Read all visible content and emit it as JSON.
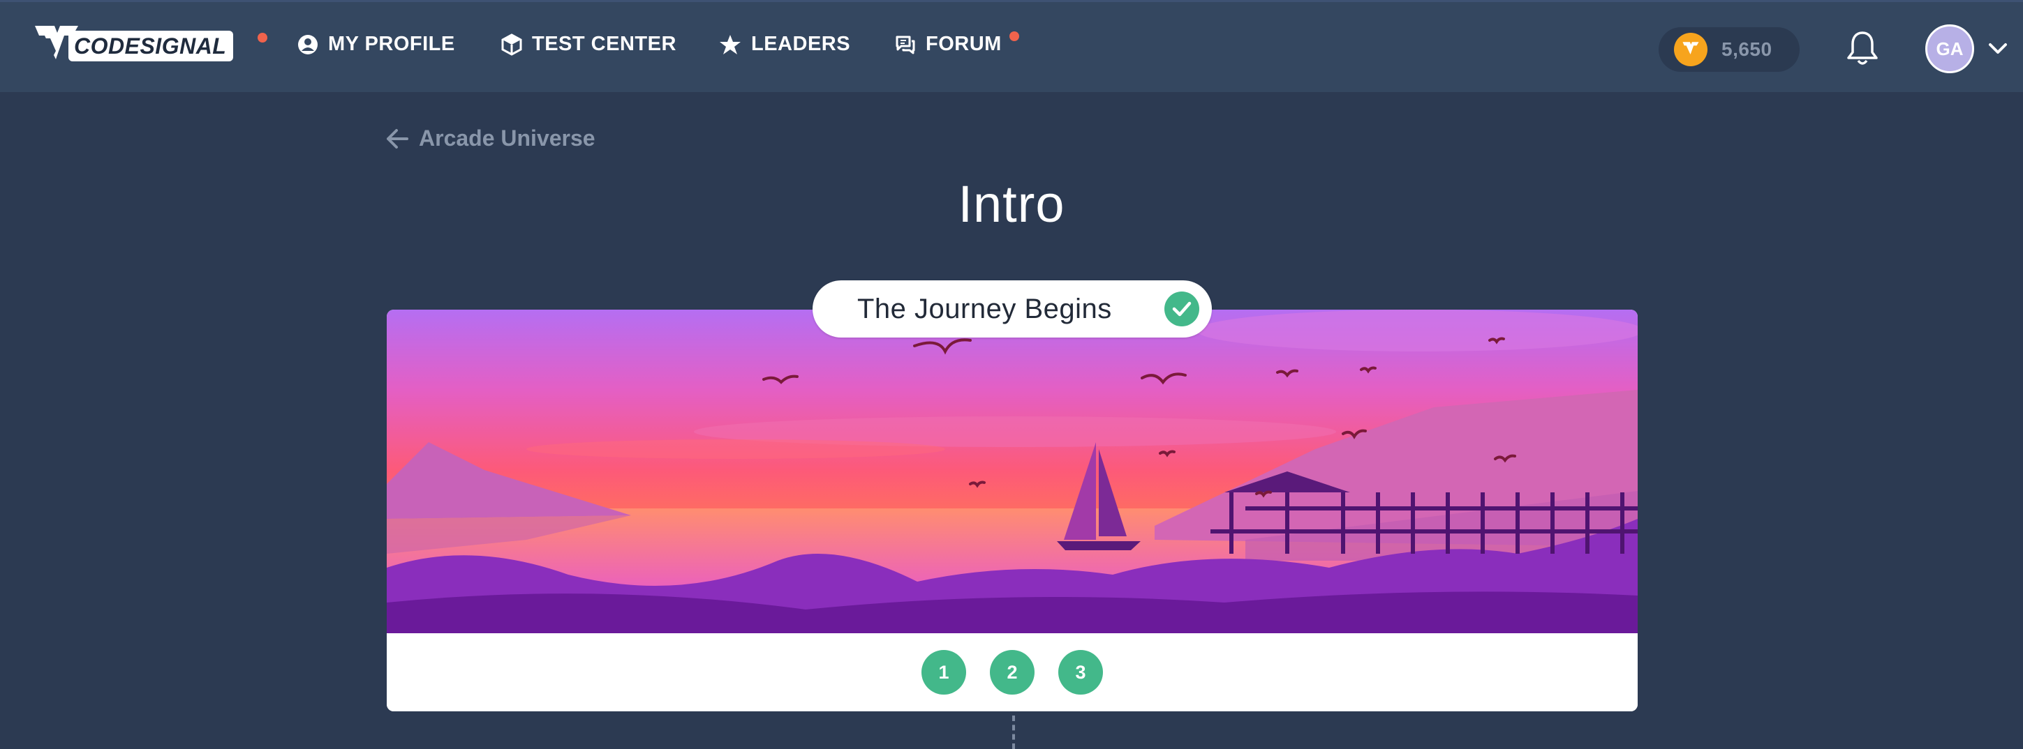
{
  "header": {
    "logo_text": "CODESIGNAL",
    "nav": [
      {
        "label": "MY PROFILE",
        "icon": "user-circle-icon"
      },
      {
        "label": "TEST CENTER",
        "icon": "cube-icon"
      },
      {
        "label": "LEADERS",
        "icon": "star-icon"
      },
      {
        "label": "FORUM",
        "icon": "chat-icon"
      }
    ],
    "coins": "5,650",
    "avatar_initials": "GA",
    "notification_color": "#f0634c"
  },
  "breadcrumb": {
    "back_label": "Arcade Universe"
  },
  "page": {
    "title": "Intro"
  },
  "chapter": {
    "name": "The Journey Begins",
    "completed": true,
    "levels": [
      "1",
      "2",
      "3"
    ],
    "accent": "#43b88a"
  }
}
